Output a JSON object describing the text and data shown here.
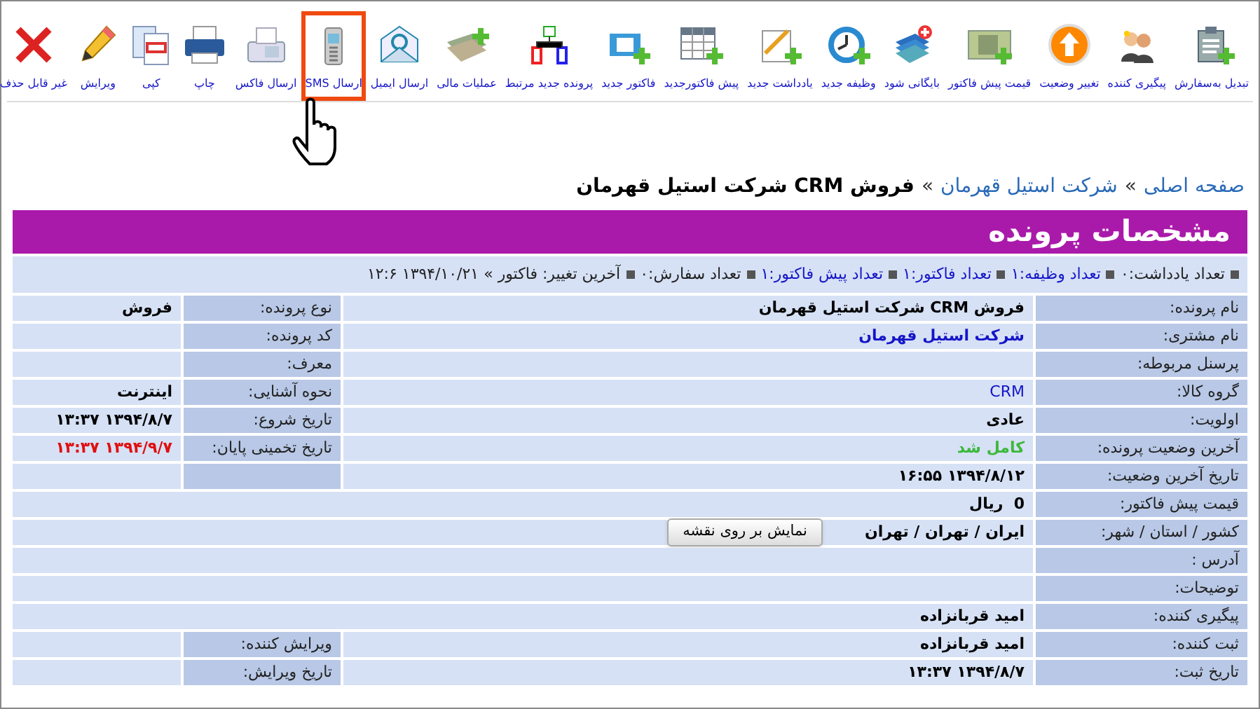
{
  "toolbar": [
    {
      "label": "تبدیل به‌سفارش",
      "selected": false
    },
    {
      "label": "پیگیری کننده",
      "selected": false
    },
    {
      "label": "تغییر وضعیت",
      "selected": false
    },
    {
      "label": "قیمت پیش فاکتور",
      "selected": false
    },
    {
      "label": "بایگانی شود",
      "selected": false
    },
    {
      "label": "وظیفه جدید",
      "selected": false
    },
    {
      "label": "یادداشت جدید",
      "selected": false
    },
    {
      "label": "پیش فاکتورجدید",
      "selected": false
    },
    {
      "label": "فاکتور جدید",
      "selected": false
    },
    {
      "label": "پرونده جدید مرتبط",
      "selected": false
    },
    {
      "label": "عملیات مالی",
      "selected": false
    },
    {
      "label": "ارسال ایمیل",
      "selected": false
    },
    {
      "label": "ارسال SMS",
      "selected": true
    },
    {
      "label": "ارسال فاکس",
      "selected": false
    },
    {
      "label": "چاپ",
      "selected": false
    },
    {
      "label": "کپی",
      "selected": false
    },
    {
      "label": "ویرایش",
      "selected": false
    },
    {
      "label": "غیر قابل حذف",
      "selected": false
    }
  ],
  "breadcrumb": [
    {
      "label": "صفحه اصلی",
      "kind": "link"
    },
    {
      "label": "»",
      "kind": "separator"
    },
    {
      "label": "شرکت استیل قهرمان",
      "kind": "link"
    },
    {
      "label": "»",
      "kind": "separator"
    },
    {
      "label": "فروش CRM شرکت استیل قهرمان",
      "kind": "current"
    }
  ],
  "title": "مشخصات پرونده",
  "summary": [
    {
      "text": "تعداد یادداشت:۰",
      "kind": "plain"
    },
    {
      "text": "تعداد وظیفه:۱",
      "kind": "link"
    },
    {
      "text": "تعداد فاکتور:۱",
      "kind": "link"
    },
    {
      "text": "تعداد پیش فاکتور:۱",
      "kind": "link"
    },
    {
      "text": "تعداد سفارش:۰",
      "kind": "plain"
    },
    {
      "text": "آخرین تغییر: فاکتور » ۱۳۹۴/۱۰/۲۱ ۱۲:۶",
      "kind": "plain"
    }
  ],
  "rows": [
    {
      "kind": "split",
      "cells": [
        {
          "label": "نام پرونده:",
          "value": "فروش CRM شرکت استیل قهرمان",
          "kind": "text"
        },
        {
          "label": "نوع پرونده:",
          "value": "فروش",
          "kind": "text"
        }
      ]
    },
    {
      "kind": "split",
      "cells": [
        {
          "label": "نام مشتری:",
          "value": "شرکت استیل قهرمان",
          "kind": "link"
        },
        {
          "label": "کد پرونده:"
        }
      ]
    },
    {
      "kind": "split",
      "cells": [
        {
          "label": "پرسنل مربوطه:"
        },
        {
          "label": "معرف:"
        }
      ]
    },
    {
      "kind": "split",
      "cells": [
        {
          "label": "گروه کالا:",
          "value": "CRM",
          "kind": "category"
        },
        {
          "label": "نحوه آشنایی:",
          "value": "اینترنت",
          "kind": "text"
        }
      ]
    },
    {
      "kind": "split",
      "cells": [
        {
          "label": "اولویت:",
          "value": "عادی",
          "kind": "text"
        },
        {
          "label": "تاریخ شروع:",
          "value": "۱۳۹۴/۸/۷ ۱۳:۳۷",
          "kind": "text"
        }
      ]
    },
    {
      "kind": "split",
      "cells": [
        {
          "label": "آخرین وضعیت پرونده:",
          "value": "کامل شد",
          "kind": "status"
        },
        {
          "label": "تاریخ تخمینی پایان:",
          "value": "۱۳۹۴/۹/۷ ۱۳:۳۷",
          "kind": "deadline"
        }
      ]
    },
    {
      "kind": "split",
      "cells": [
        {
          "label": "تاریخ آخرین وضعیت:",
          "value": "۱۳۹۴/۸/۱۲ ۱۶:۵۵",
          "kind": "text"
        },
        {}
      ]
    },
    {
      "kind": "wide",
      "cells": [
        {
          "label": "قیمت پیش فاکتور:",
          "value": "0  ریال",
          "kind": "text"
        }
      ]
    },
    {
      "kind": "wide",
      "cells": [
        {
          "label": "کشور / استان / شهر:",
          "value": "ایران / تهران / تهران",
          "kind": "text",
          "button": "نمایش بر روی نقشه"
        }
      ]
    },
    {
      "kind": "wide",
      "cells": [
        {
          "label": "آدرس :"
        }
      ]
    },
    {
      "kind": "wide",
      "cells": [
        {
          "label": "توضیحات:"
        }
      ]
    },
    {
      "kind": "wide",
      "cells": [
        {
          "label": "پیگیری کننده:",
          "value": "امید قربانزاده",
          "kind": "text"
        }
      ]
    },
    {
      "kind": "split",
      "cells": [
        {
          "label": "ثبت کننده:",
          "value": "امید قربانزاده",
          "kind": "text"
        },
        {
          "label": "ویرایش کننده:"
        }
      ]
    },
    {
      "kind": "split",
      "cells": [
        {
          "label": "تاریخ ثبت:",
          "value": "۱۳۹۴/۸/۷ ۱۳:۳۷",
          "kind": "text"
        },
        {
          "label": "تاریخ ویرایش:"
        }
      ]
    }
  ]
}
